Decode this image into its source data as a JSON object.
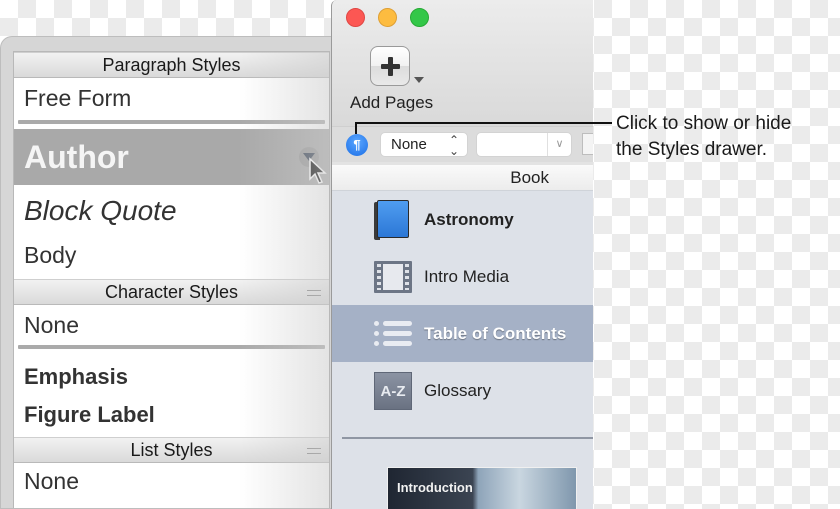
{
  "styles_drawer": {
    "paragraph_styles": {
      "header": "Paragraph Styles",
      "items": [
        {
          "label": "Free Form"
        },
        {
          "label": "Author",
          "selected": true
        },
        {
          "label": "Block Quote"
        },
        {
          "label": "Body"
        }
      ]
    },
    "character_styles": {
      "header": "Character Styles",
      "items": [
        {
          "label": "None"
        },
        {
          "label": "Emphasis"
        },
        {
          "label": "Figure Label"
        }
      ]
    },
    "list_styles": {
      "header": "List Styles",
      "items": [
        {
          "label": "None"
        }
      ]
    }
  },
  "window": {
    "toolbar": {
      "add_pages_label": "Add Pages",
      "add_pages_icon": "plus-icon"
    },
    "format_bar": {
      "styles_drawer_toggle_glyph": "¶",
      "paragraph_style_value": "None",
      "font_value": ""
    },
    "sidebar": {
      "header": "Book",
      "items": [
        {
          "label": "Astronomy",
          "icon": "book-icon"
        },
        {
          "label": "Intro Media",
          "icon": "film-icon"
        },
        {
          "label": "Table of Contents",
          "icon": "list-icon",
          "selected": true
        },
        {
          "label": "Glossary",
          "icon": "glossary-az-icon",
          "icon_text": "A-Z"
        }
      ],
      "thumbnail_label": "Introduction"
    }
  },
  "callout": {
    "line1": "Click to show or hide",
    "line2": "the Styles drawer."
  },
  "colors": {
    "selected_style_bg": "#a9a9a9",
    "selected_nav_bg": "#a5b1c6",
    "toggle_blue": "#1c6fe6",
    "close": "#fc5753",
    "minimize": "#fdbc40",
    "zoom": "#33c748"
  }
}
